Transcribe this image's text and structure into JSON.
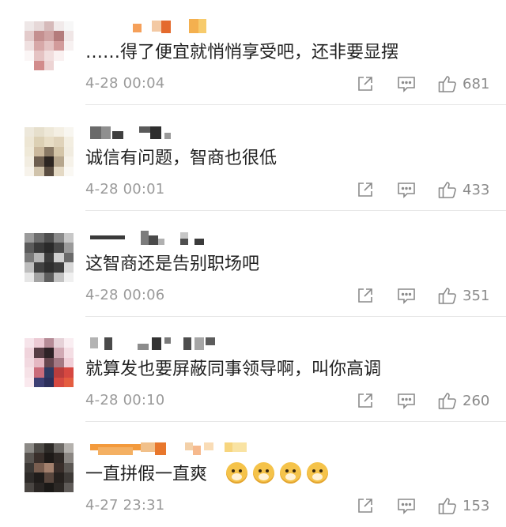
{
  "comments": [
    {
      "text": "……得了便宜就悄悄享受吧，还非要显摆",
      "time": "4-28 00:04",
      "likes": "681",
      "emoji_count": 0
    },
    {
      "text": "诚信有问题，智商也很低",
      "time": "4-28 00:01",
      "likes": "433",
      "emoji_count": 0
    },
    {
      "text": "这智商还是告别职场吧",
      "time": "4-28 00:06",
      "likes": "351",
      "emoji_count": 0
    },
    {
      "text": "就算发也要屏蔽同事领导啊，叫你高调",
      "time": "4-28 00:10",
      "likes": "260",
      "emoji_count": 0
    },
    {
      "text": "一直拼假一直爽",
      "time": "4-27 23:31",
      "likes": "153",
      "emoji_count": 4
    }
  ],
  "icons": {
    "share": "share-icon",
    "reply": "comment-icon",
    "like": "thumbs-up-icon",
    "emoji": "doge-emoji-icon"
  },
  "colors": {
    "text": "#222222",
    "meta": "#9a9a9a",
    "divider": "#e6e6e6",
    "username_redacted_orange": "#f39a3c"
  }
}
